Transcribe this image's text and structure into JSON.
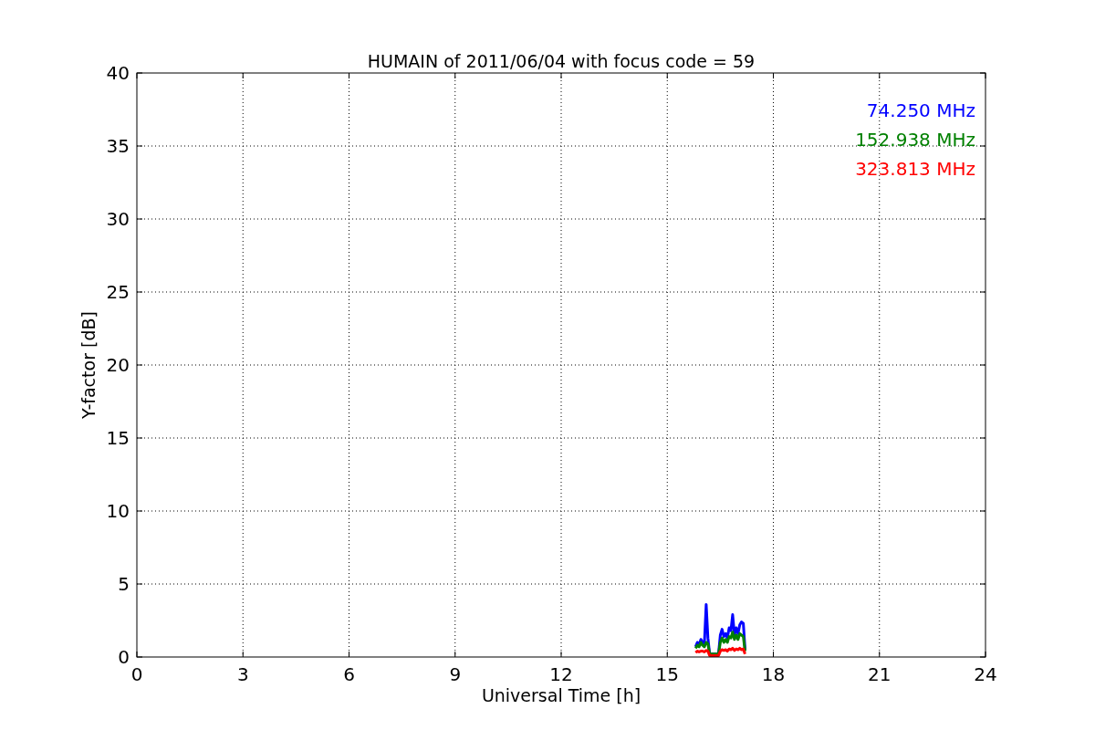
{
  "chart": {
    "chart_data": {
      "type": "line",
      "title": "HUMAIN of 2011/06/04 with focus code = 59",
      "xlabel": "Universal Time [h]",
      "ylabel": "Y-factor [dB]",
      "x": [
        15.8,
        15.85,
        15.9,
        15.95,
        16.0,
        16.05,
        16.1,
        16.15,
        16.2,
        16.25,
        16.3,
        16.35,
        16.4,
        16.45,
        16.5,
        16.55,
        16.6,
        16.65,
        16.7,
        16.75,
        16.8,
        16.85,
        16.9,
        16.95,
        17.0,
        17.05,
        17.1,
        17.15,
        17.2
      ],
      "series": [
        {
          "name": "74.250 MHz",
          "color": "#0000ff",
          "values": [
            0.7,
            1.0,
            0.8,
            1.2,
            1.0,
            0.9,
            3.6,
            1.3,
            0.2,
            0.2,
            0.2,
            0.2,
            0.2,
            0.2,
            1.5,
            1.9,
            1.4,
            1.6,
            1.3,
            2.0,
            1.8,
            2.9,
            1.5,
            2.0,
            1.6,
            2.2,
            2.4,
            2.3,
            0.5
          ]
        },
        {
          "name": "152.938 MHz",
          "color": "#008000",
          "values": [
            0.6,
            0.8,
            0.7,
            1.0,
            0.8,
            0.7,
            1.0,
            0.9,
            0.2,
            0.2,
            0.2,
            0.2,
            0.2,
            0.2,
            1.0,
            1.3,
            1.0,
            1.2,
            1.0,
            1.4,
            1.3,
            1.7,
            1.2,
            1.5,
            1.2,
            1.6,
            1.5,
            1.4,
            0.4
          ]
        },
        {
          "name": "323.813 MHz",
          "color": "#ff0000",
          "values": [
            0.3,
            0.4,
            0.35,
            0.4,
            0.4,
            0.35,
            0.45,
            0.4,
            0.1,
            0.1,
            0.1,
            0.1,
            0.1,
            0.1,
            0.4,
            0.5,
            0.45,
            0.5,
            0.4,
            0.55,
            0.5,
            0.6,
            0.45,
            0.55,
            0.5,
            0.6,
            0.5,
            0.55,
            0.2
          ]
        }
      ],
      "grid": true,
      "xlim": [
        0,
        24
      ],
      "ylim": [
        0,
        40
      ],
      "xticks": [
        0,
        3,
        6,
        9,
        12,
        15,
        18,
        21,
        24
      ],
      "yticks": [
        0,
        5,
        10,
        15,
        20,
        25,
        30,
        35,
        40
      ]
    }
  }
}
